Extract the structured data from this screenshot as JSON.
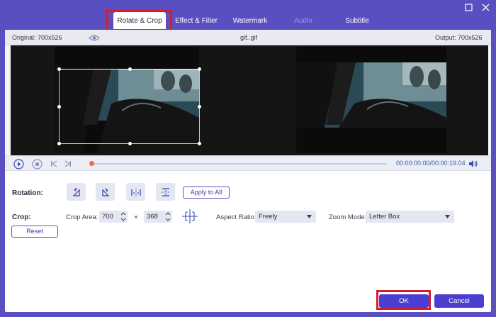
{
  "tabs": [
    {
      "label": "Rotate & Crop"
    },
    {
      "label": "Effect & Filter"
    },
    {
      "label": "Watermark"
    },
    {
      "label": "Audio"
    },
    {
      "label": "Subtitle"
    }
  ],
  "info": {
    "original": "Original: 700x526",
    "filename": "gif..gif",
    "output": "Output: 700x526"
  },
  "timeline": {
    "time": "00:00:00.00/00:00:19.04",
    "progress": 0
  },
  "rotation": {
    "label": "Rotation:",
    "apply_label": "Apply to All"
  },
  "crop": {
    "label": "Crop:",
    "area_label": "Crop Area:",
    "width": "700",
    "height": "368",
    "times": "×",
    "aspect_label": "Aspect Ratio:",
    "aspect_value": "Freely",
    "zoom_label": "Zoom Mode:",
    "zoom_value": "Letter Box",
    "reset_label": "Reset"
  },
  "actions": {
    "ok_label": "OK",
    "cancel_label": "Cancel"
  },
  "colors": {
    "accent": "#5a4fc0",
    "highlight": "#d91c2a",
    "playhead": "#f36b3d"
  }
}
